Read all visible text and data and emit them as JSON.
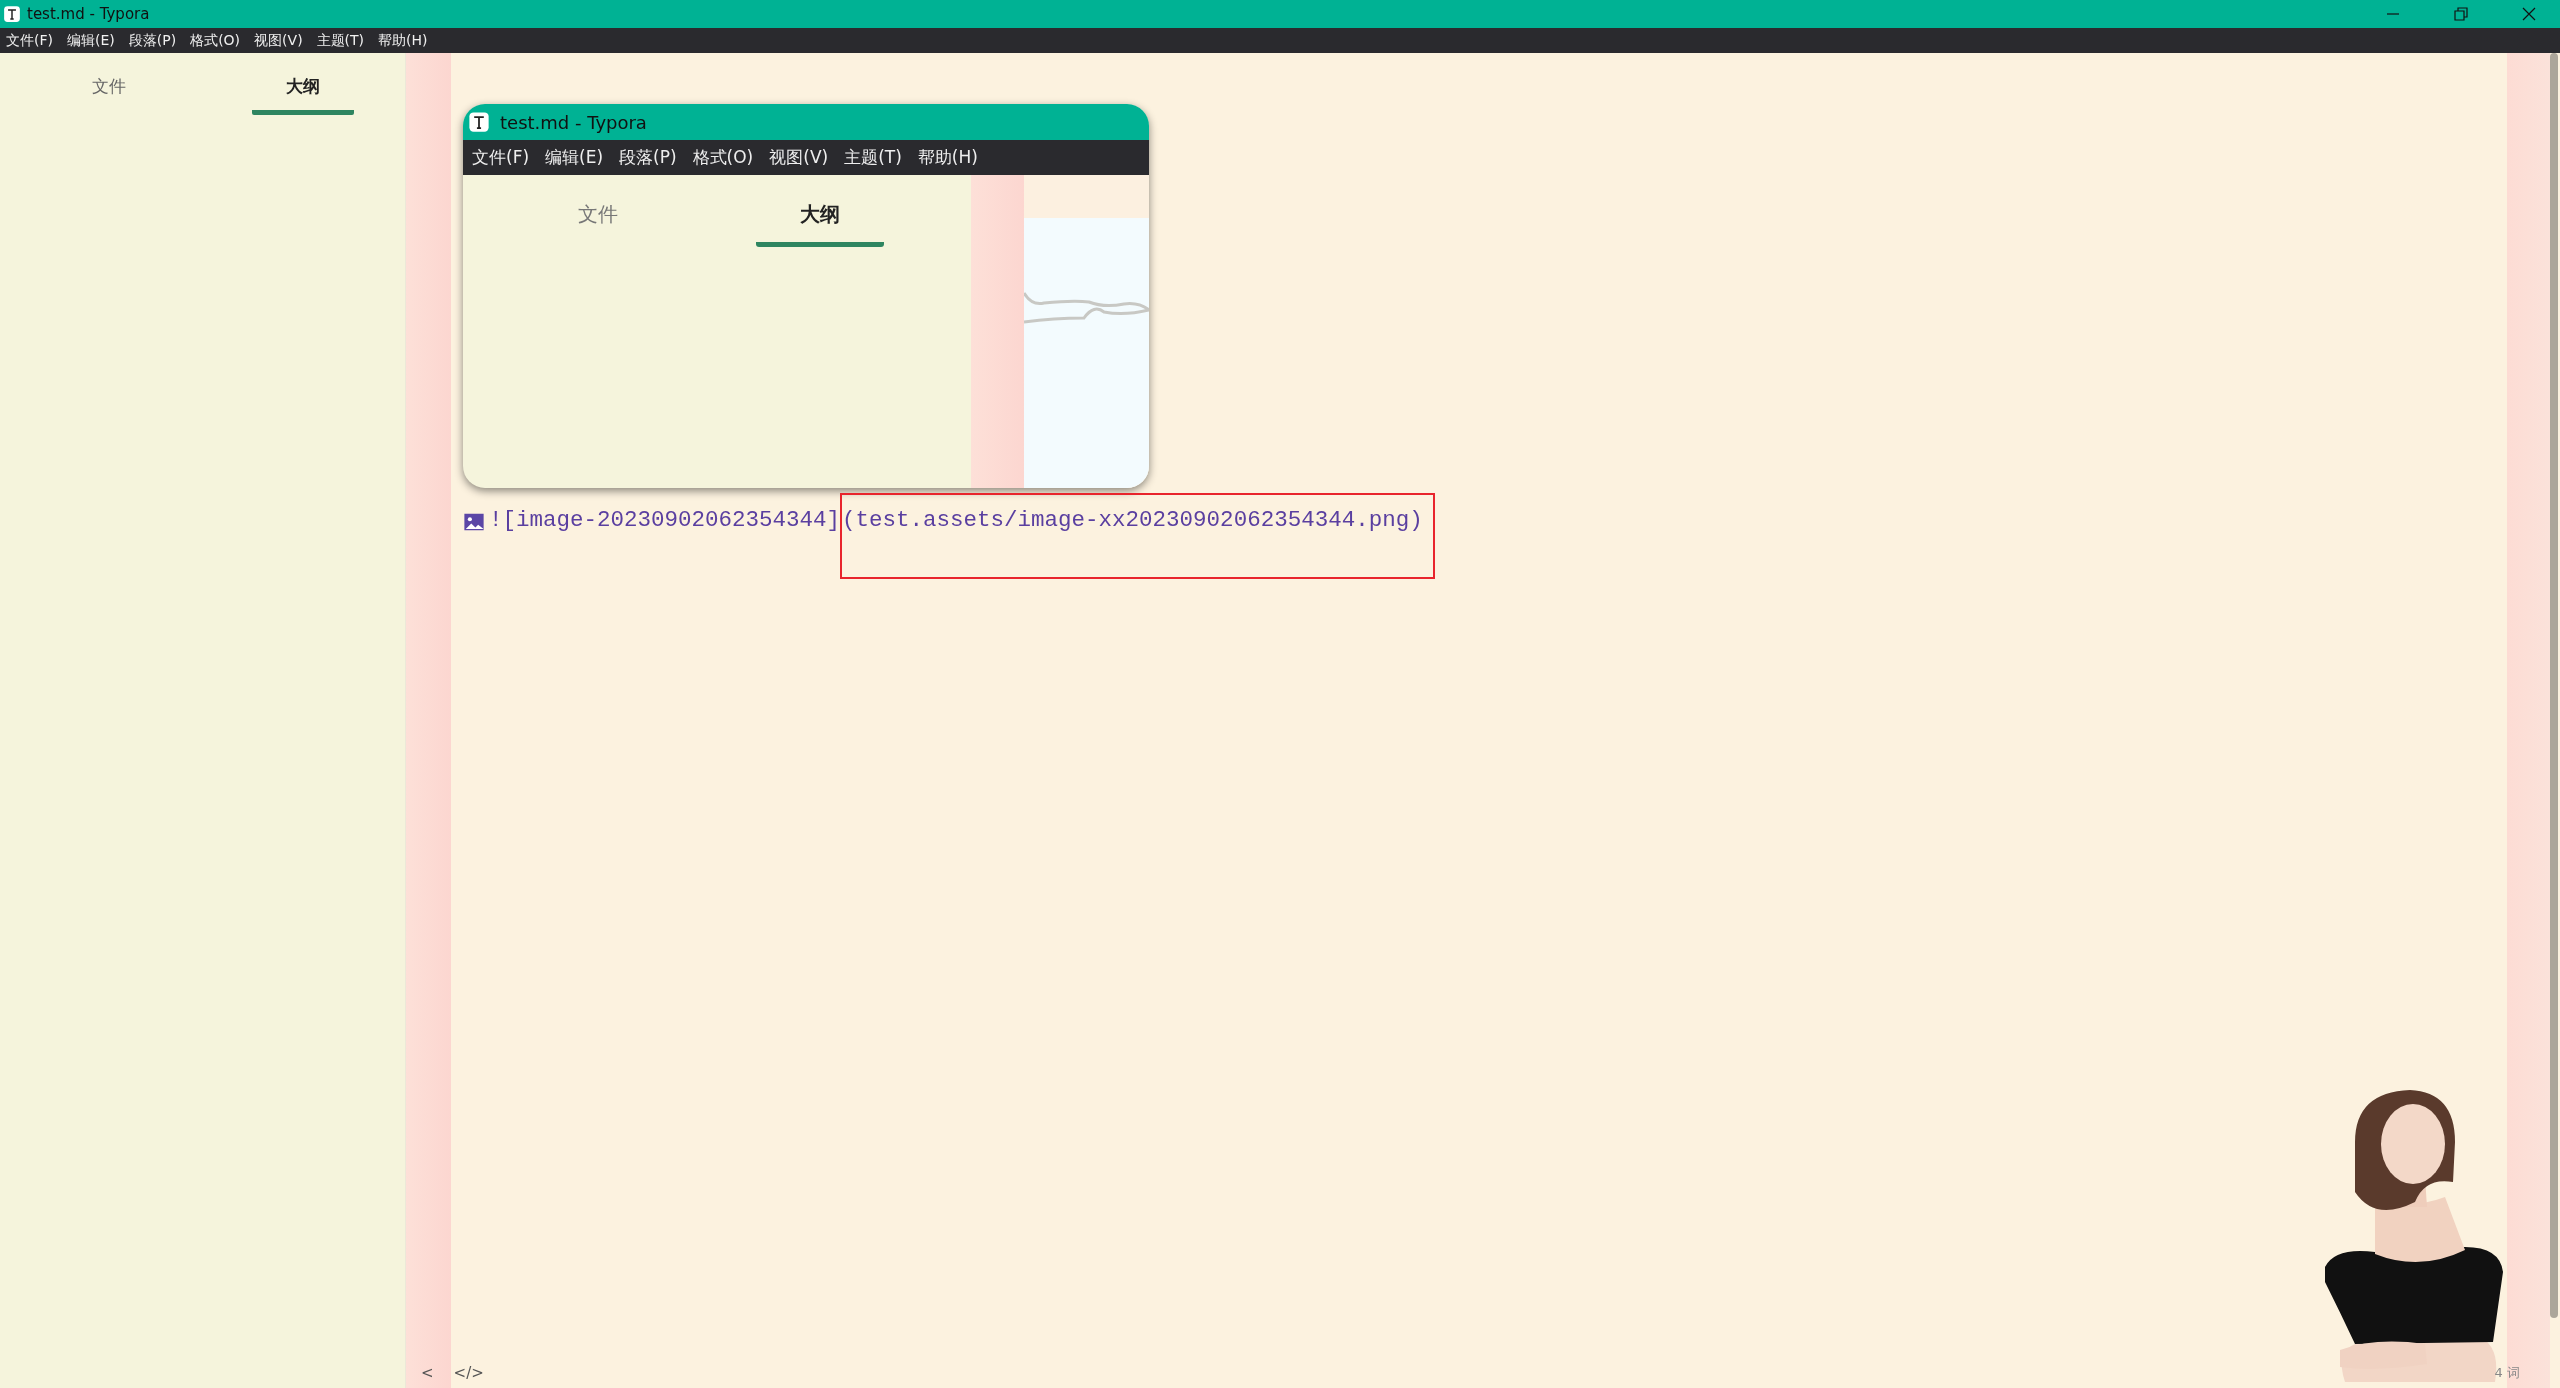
{
  "window": {
    "title": "test.md - Typora"
  },
  "menu": [
    "文件(F)",
    "编辑(E)",
    "段落(P)",
    "格式(O)",
    "视图(V)",
    "主题(T)",
    "帮助(H)"
  ],
  "sidebar": {
    "tabs": [
      {
        "label": "文件",
        "selected": false
      },
      {
        "label": "大纲",
        "selected": true
      }
    ]
  },
  "editor": {
    "embedded_image": {
      "title": "test.md - Typora",
      "menu": [
        "文件(F)",
        "编辑(E)",
        "段落(P)",
        "格式(O)",
        "视图(V)",
        "主题(T)",
        "帮助(H)"
      ],
      "tabs": [
        {
          "label": "文件",
          "selected": false
        },
        {
          "label": "大纲",
          "selected": true
        }
      ]
    },
    "source_line": {
      "alt": "![image-20230902062354344]",
      "path": "(test.assets/image-xx20230902062354344.png)",
      "highlighted": true
    }
  },
  "status_bar": {
    "toggle": "<",
    "source_mode": "</>",
    "word_count": "4 词"
  }
}
